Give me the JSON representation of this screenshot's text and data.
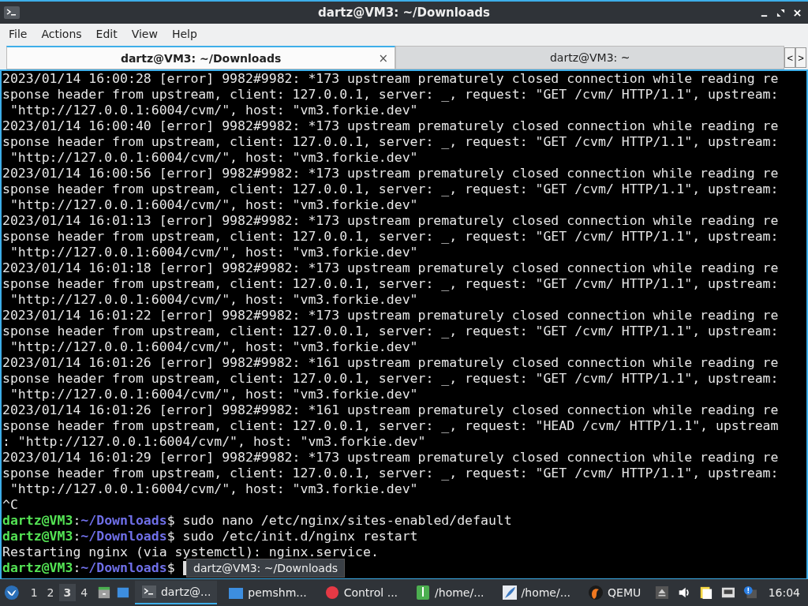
{
  "window": {
    "title": "dartz@VM3: ~/Downloads"
  },
  "menu": [
    "File",
    "Actions",
    "Edit",
    "View",
    "Help"
  ],
  "tabs": [
    {
      "label": "dartz@VM3: ~/Downloads",
      "selected": true,
      "close": "×"
    },
    {
      "label": "dartz@VM3: ~",
      "selected": false
    }
  ],
  "tab_scroll": [
    "<",
    ">"
  ],
  "terminal": {
    "lines": [
      {
        "kind": "output",
        "text": "2023/01/14 16:00:28 [error] 9982#9982: *173 upstream prematurely closed connection while reading re"
      },
      {
        "kind": "output",
        "text": "sponse header from upstream, client: 127.0.0.1, server: _, request: \"GET /cvm/ HTTP/1.1\", upstream:"
      },
      {
        "kind": "output",
        "text": " \"http://127.0.0.1:6004/cvm/\", host: \"vm3.forkie.dev\""
      },
      {
        "kind": "output",
        "text": "2023/01/14 16:00:40 [error] 9982#9982: *173 upstream prematurely closed connection while reading re"
      },
      {
        "kind": "output",
        "text": "sponse header from upstream, client: 127.0.0.1, server: _, request: \"GET /cvm/ HTTP/1.1\", upstream:"
      },
      {
        "kind": "output",
        "text": " \"http://127.0.0.1:6004/cvm/\", host: \"vm3.forkie.dev\""
      },
      {
        "kind": "output",
        "text": "2023/01/14 16:00:56 [error] 9982#9982: *173 upstream prematurely closed connection while reading re"
      },
      {
        "kind": "output",
        "text": "sponse header from upstream, client: 127.0.0.1, server: _, request: \"GET /cvm/ HTTP/1.1\", upstream:"
      },
      {
        "kind": "output",
        "text": " \"http://127.0.0.1:6004/cvm/\", host: \"vm3.forkie.dev\""
      },
      {
        "kind": "output",
        "text": "2023/01/14 16:01:13 [error] 9982#9982: *173 upstream prematurely closed connection while reading re"
      },
      {
        "kind": "output",
        "text": "sponse header from upstream, client: 127.0.0.1, server: _, request: \"GET /cvm/ HTTP/1.1\", upstream:"
      },
      {
        "kind": "output",
        "text": " \"http://127.0.0.1:6004/cvm/\", host: \"vm3.forkie.dev\""
      },
      {
        "kind": "output",
        "text": "2023/01/14 16:01:18 [error] 9982#9982: *173 upstream prematurely closed connection while reading re"
      },
      {
        "kind": "output",
        "text": "sponse header from upstream, client: 127.0.0.1, server: _, request: \"GET /cvm/ HTTP/1.1\", upstream:"
      },
      {
        "kind": "output",
        "text": " \"http://127.0.0.1:6004/cvm/\", host: \"vm3.forkie.dev\""
      },
      {
        "kind": "output",
        "text": "2023/01/14 16:01:22 [error] 9982#9982: *173 upstream prematurely closed connection while reading re"
      },
      {
        "kind": "output",
        "text": "sponse header from upstream, client: 127.0.0.1, server: _, request: \"GET /cvm/ HTTP/1.1\", upstream:"
      },
      {
        "kind": "output",
        "text": " \"http://127.0.0.1:6004/cvm/\", host: \"vm3.forkie.dev\""
      },
      {
        "kind": "output",
        "text": "2023/01/14 16:01:26 [error] 9982#9982: *161 upstream prematurely closed connection while reading re"
      },
      {
        "kind": "output",
        "text": "sponse header from upstream, client: 127.0.0.1, server: _, request: \"GET /cvm/ HTTP/1.1\", upstream:"
      },
      {
        "kind": "output",
        "text": " \"http://127.0.0.1:6004/cvm/\", host: \"vm3.forkie.dev\""
      },
      {
        "kind": "output",
        "text": "2023/01/14 16:01:26 [error] 9982#9982: *161 upstream prematurely closed connection while reading re"
      },
      {
        "kind": "output",
        "text": "sponse header from upstream, client: 127.0.0.1, server: _, request: \"HEAD /cvm/ HTTP/1.1\", upstream"
      },
      {
        "kind": "output",
        "text": ": \"http://127.0.0.1:6004/cvm/\", host: \"vm3.forkie.dev\""
      },
      {
        "kind": "output",
        "text": "2023/01/14 16:01:29 [error] 9982#9982: *173 upstream prematurely closed connection while reading re"
      },
      {
        "kind": "output",
        "text": "sponse header from upstream, client: 127.0.0.1, server: _, request: \"GET /cvm/ HTTP/1.1\", upstream:"
      },
      {
        "kind": "output",
        "text": " \"http://127.0.0.1:6004/cvm/\", host: \"vm3.forkie.dev\""
      },
      {
        "kind": "output",
        "text": "^C"
      },
      {
        "kind": "prompt",
        "user": "dartz@VM3",
        "separator": ":",
        "path": "~/Downloads",
        "symbol": "$",
        "command": " sudo nano /etc/nginx/sites-enabled/default"
      },
      {
        "kind": "prompt",
        "user": "dartz@VM3",
        "separator": ":",
        "path": "~/Downloads",
        "symbol": "$",
        "command": " sudo /etc/init.d/nginx restart"
      },
      {
        "kind": "output",
        "text": "Restarting nginx (via systemctl): nginx.service."
      },
      {
        "kind": "prompt",
        "user": "dartz@VM3",
        "separator": ":",
        "path": "~/Downloads",
        "symbol": "$",
        "cursor": true
      }
    ]
  },
  "tooltip": "dartz@VM3: ~/Downloads",
  "taskbar": {
    "workspaces": [
      {
        "label": "1",
        "selected": false
      },
      {
        "label": "2",
        "selected": false
      },
      {
        "label": "3",
        "selected": true
      },
      {
        "label": "4",
        "selected": false
      }
    ],
    "tasks": [
      {
        "kind": "terminal",
        "label": "dartz@...",
        "selected": true
      },
      {
        "kind": "window",
        "label": "pemshm...",
        "selected": false
      },
      {
        "kind": "record",
        "label": "Control ...",
        "selected": false
      },
      {
        "kind": "archive",
        "label": "/home/...",
        "selected": false
      },
      {
        "kind": "feather",
        "label": "/home/...",
        "selected": false
      },
      {
        "kind": "qemu",
        "label": "QEMU",
        "selected": false
      }
    ],
    "clock": "16:04"
  }
}
